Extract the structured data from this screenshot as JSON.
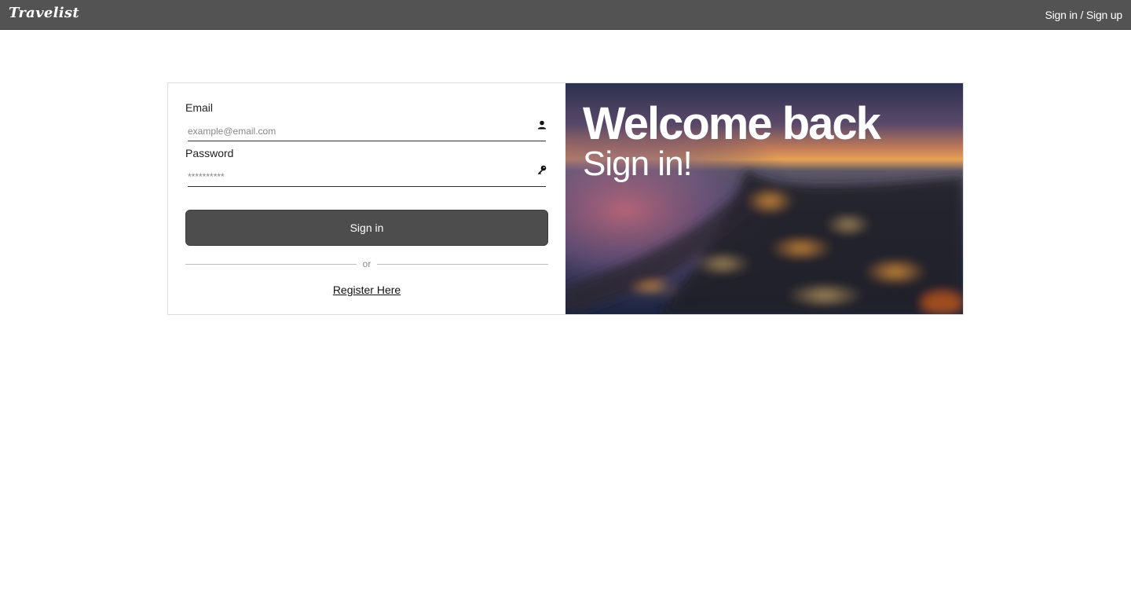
{
  "header": {
    "logo": "Travelist",
    "auth_link": "Sign in / Sign up"
  },
  "form": {
    "email": {
      "label": "Email",
      "placeholder": "example@email.com",
      "value": "",
      "icon": "user-icon"
    },
    "password": {
      "label": "Password",
      "placeholder": "**********",
      "value": "",
      "icon": "key-icon"
    },
    "submit_label": "Sign in",
    "divider_text": "or",
    "register_label": "Register Here"
  },
  "hero": {
    "title": "Welcome back",
    "subtitle": "Sign in!",
    "image": "blurred-city-sunset-photo"
  },
  "colors": {
    "topbar": "#535353",
    "button": "#4d4d4d",
    "text": "#222222"
  }
}
